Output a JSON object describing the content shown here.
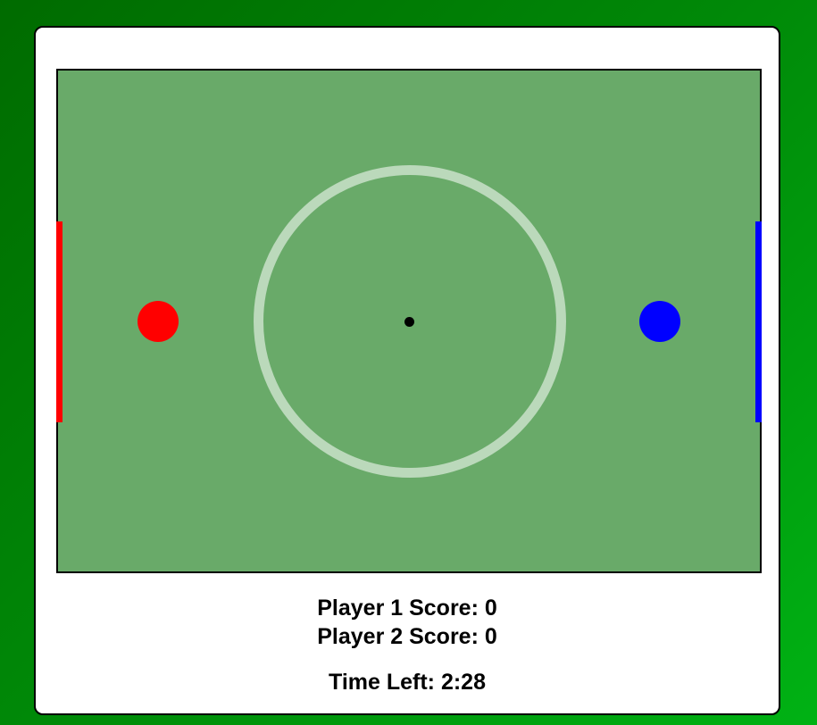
{
  "game": {
    "field_color": "#69aa69",
    "background_color": "#008a08",
    "center_circle_color": "rgba(255,255,255,0.55)",
    "ball_color": "#000000",
    "player1": {
      "color": "#ff0000",
      "goal_color": "#ff0000"
    },
    "player2": {
      "color": "#0000ff",
      "goal_color": "#0000ff"
    }
  },
  "scoreboard": {
    "player1_text": "Player 1 Score: 0",
    "player2_text": "Player 2 Score: 0",
    "timer_text": "Time Left: 2:28"
  }
}
